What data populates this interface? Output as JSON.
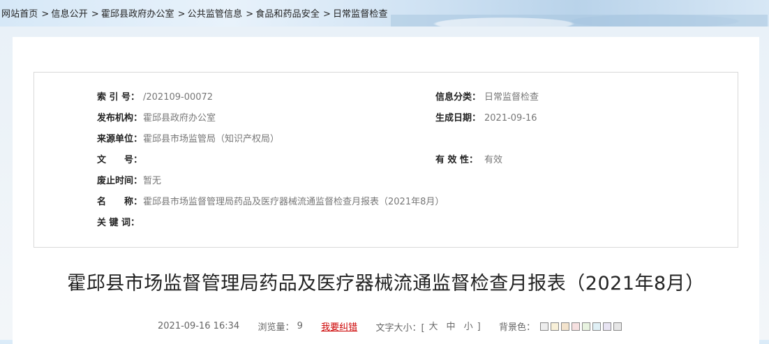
{
  "breadcrumb": {
    "items": [
      "网站首页",
      "信息公开",
      "霍邱县政府办公室",
      "公共监管信息",
      "食品和药品安全",
      "日常监督检查"
    ],
    "separator": ">"
  },
  "meta": {
    "index_label": "索 引 号：",
    "index_value": "/202109-00072",
    "category_label": "信息分类：",
    "category_value": "日常监督检查",
    "publisher_label": "发布机构：",
    "publisher_value": "霍邱县政府办公室",
    "date_label": "生成日期：",
    "date_value": "2021-09-16",
    "source_label": "来源单位：",
    "source_value": "霍邱县市场监管局（知识产权局）",
    "docno_label": "文　　号：",
    "docno_value": "",
    "validity_label": "有 效 性：",
    "validity_value": "有效",
    "repeal_label": "废止时间：",
    "repeal_value": "暂无",
    "name_label": "名　　称：",
    "name_value": "霍邱县市场监督管理局药品及医疗器械流通监督检查月报表（2021年8月）",
    "keywords_label": "关 键 词：",
    "keywords_value": ""
  },
  "article": {
    "title": "霍邱县市场监督管理局药品及医疗器械流通监督检查月报表（2021年8月）",
    "datetime": "2021-09-16 16:34",
    "views_label": "浏览量：",
    "views": "9",
    "correction_link": "我要纠错",
    "fontsize_label": "文字大小：[",
    "fontsize_large": "大",
    "fontsize_medium": "中",
    "fontsize_small": "小",
    "fontsize_end": "]",
    "bgcolor_label": "背景色：",
    "bg_swatches": [
      "#eeeeee",
      "#f8f0d8",
      "#f3e3cc",
      "#f6e0e0",
      "#e8f3e0",
      "#e0f0f6",
      "#e8e4f3",
      "#e6e6e6"
    ]
  }
}
